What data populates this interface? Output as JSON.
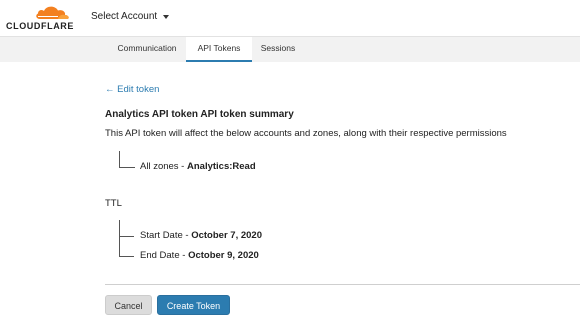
{
  "brand": {
    "logo_text": "CLOUDFLARE",
    "accent": "#f38020"
  },
  "header": {
    "account_select": "Select Account"
  },
  "tabs": [
    {
      "label": "Communication"
    },
    {
      "label": "API Tokens",
      "active": true
    },
    {
      "label": "Sessions"
    }
  ],
  "main": {
    "edit_link": "← Edit token",
    "title": "Analytics API token API token summary",
    "description": "This API token will affect the below accounts and zones, along with their respective permissions",
    "zones": {
      "prefix": "All zones - ",
      "permission": "Analytics:Read"
    },
    "ttl": {
      "label": "TTL",
      "start_prefix": "Start Date - ",
      "start_date": "October 7, 2020",
      "end_prefix": "End Date - ",
      "end_date": "October 9, 2020"
    }
  },
  "actions": {
    "cancel": "Cancel",
    "create": "Create Token"
  },
  "colors": {
    "link": "#2c7cb0",
    "primary_button": "#2c7cb0",
    "secondary_button": "#dcdcdc"
  }
}
